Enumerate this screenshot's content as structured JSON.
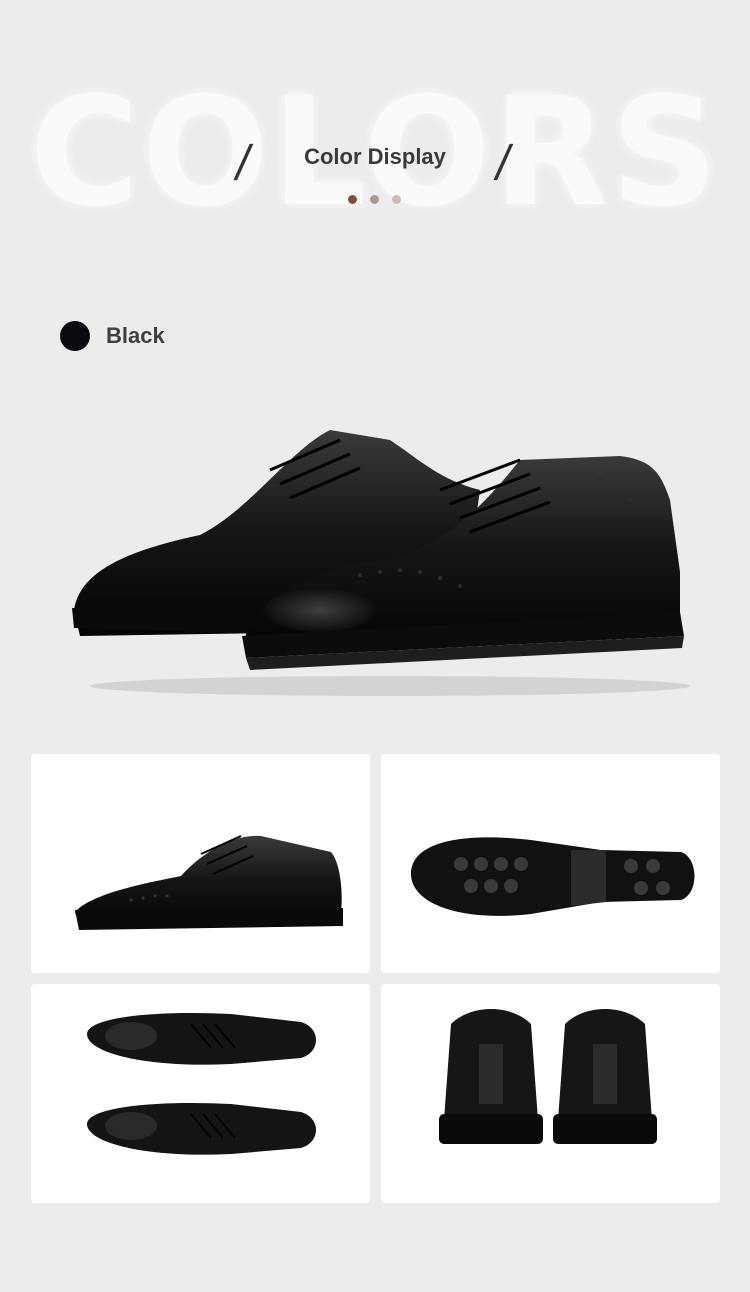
{
  "header": {
    "bg_word": "COLORS",
    "title": "Color Display",
    "slash": "/",
    "dots": [
      "#7a5238",
      "#a89a92",
      "#c7bebb"
    ]
  },
  "color_option": {
    "label": "Black",
    "swatch_color": "#0d0b10"
  },
  "gallery": [
    {
      "view": "side-view"
    },
    {
      "view": "sole-view"
    },
    {
      "view": "top-view"
    },
    {
      "view": "back-view"
    }
  ]
}
